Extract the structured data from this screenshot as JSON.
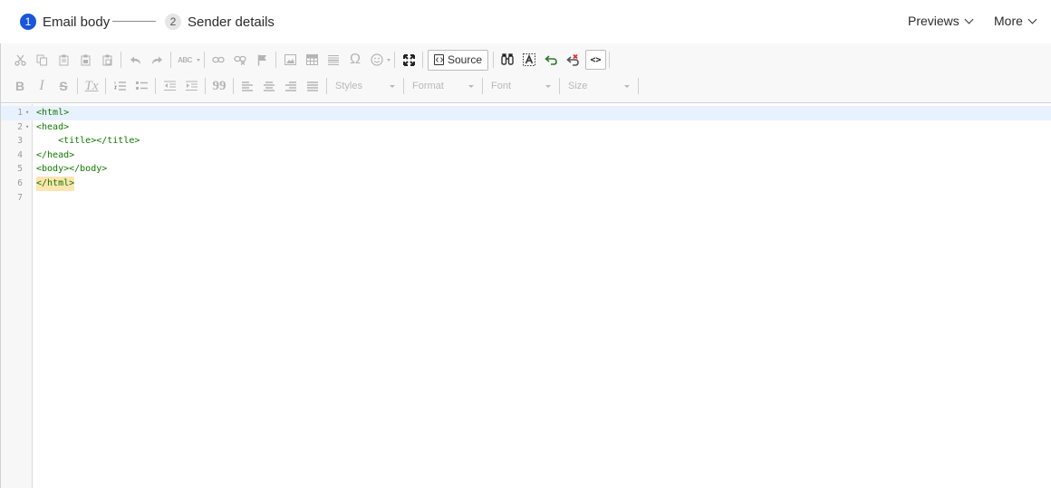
{
  "stepper": {
    "steps": [
      {
        "number": "1",
        "label": "Email body",
        "active": true
      },
      {
        "number": "2",
        "label": "Sender details",
        "active": false
      }
    ]
  },
  "top_menu": {
    "previews_label": "Previews",
    "more_label": "More"
  },
  "toolbar": {
    "row1_icons": [
      "cut-icon",
      "copy-icon",
      "paste-icon",
      "paste-text-icon",
      "paste-word-icon",
      "undo-icon",
      "redo-icon",
      "spellcheck-icon",
      "link-icon",
      "unlink-icon",
      "anchor-icon",
      "image-icon",
      "table-icon",
      "horizontal-line-icon",
      "special-char-icon",
      "emoji-icon",
      "maximize-icon",
      "find-icon",
      "select-all-icon",
      "undo-format-icon",
      "remove-format-icon"
    ],
    "source_label": "Source",
    "code_view_label": "<>",
    "row2_icons": [
      "bold-icon",
      "italic-icon",
      "strikethrough-icon",
      "remove-format-icon",
      "numbered-list-icon",
      "bulleted-list-icon",
      "decrease-indent-icon",
      "increase-indent-icon",
      "blockquote-icon",
      "align-left-icon",
      "align-center-icon",
      "align-right-icon",
      "justify-icon"
    ],
    "combos": {
      "styles": "Styles",
      "format": "Format",
      "font": "Font",
      "size": "Size"
    },
    "glyphs": {
      "bold": "B",
      "italic": "I",
      "strike": "S",
      "clear": "Tx",
      "omega": "Ω",
      "quote": "99"
    }
  },
  "code_editor": {
    "lines": [
      {
        "num": "1",
        "text": "<html>",
        "foldable": true,
        "current": true
      },
      {
        "num": "2",
        "text": "<head>",
        "foldable": true,
        "current": false
      },
      {
        "num": "3",
        "text": "    <title></title>",
        "foldable": false,
        "current": false
      },
      {
        "num": "4",
        "text": "</head>",
        "foldable": false,
        "current": false
      },
      {
        "num": "5",
        "text": "<body></body>",
        "foldable": false,
        "current": false
      },
      {
        "num": "6",
        "text": "</html>",
        "foldable": false,
        "current": false,
        "bracket_match": true
      },
      {
        "num": "7",
        "text": "",
        "foldable": false,
        "current": false
      }
    ],
    "fold_marker": "▾"
  },
  "colors": {
    "accent": "#1a56db",
    "code_tag": "#117700",
    "current_line": "#e8f2ff",
    "bracket_match": "#fce5b0",
    "disabled_icon": "#b4b4b4"
  }
}
